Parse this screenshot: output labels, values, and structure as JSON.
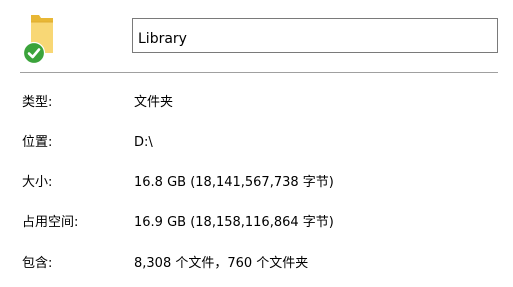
{
  "header": {
    "folder_icon": "folder-with-sync-check-icon",
    "name_value": "Library"
  },
  "properties": [
    {
      "label": "类型:",
      "value": "文件夹"
    },
    {
      "label": "位置:",
      "value": "D:\\"
    },
    {
      "label": "大小:",
      "value": "16.8 GB (18,141,567,738 字节)"
    },
    {
      "label": "占用空间:",
      "value": "16.9 GB (18,158,116,864 字节)"
    },
    {
      "label": "包含:",
      "value": "8,308 个文件，760 个文件夹"
    }
  ],
  "colors": {
    "folder_back": "#E8B735",
    "folder_front": "#F8D775",
    "status_green": "#3BA33B",
    "field_border": "#7A7A7A",
    "divider": "#A0A0A0"
  }
}
